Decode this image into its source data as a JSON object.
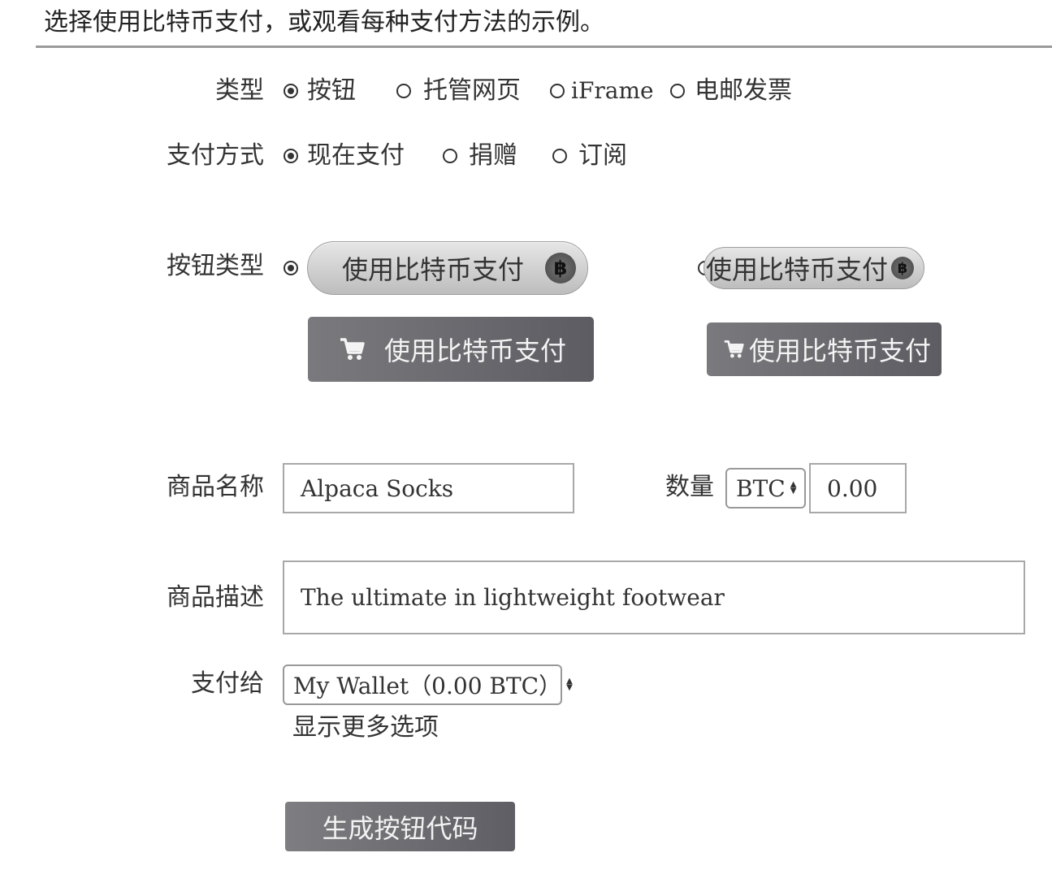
{
  "intro": "选择使用比特币支付，或观看每种支付方法的示例。",
  "type_row": {
    "label": "类型",
    "options": [
      "按钮",
      "托管网页",
      "iFrame",
      "电邮发票"
    ],
    "selected": "按钮"
  },
  "method_row": {
    "label": "支付方式",
    "options": [
      "现在支付",
      "捐赠",
      "订阅"
    ],
    "selected": "现在支付"
  },
  "button_style": {
    "label": "按钮类型",
    "button_text": "使用比特币支付",
    "coin_symbol": "฿",
    "cart_icon": "cart-icon",
    "coin_icon": "bitcoin-icon",
    "selected_index": 0
  },
  "item": {
    "name_label": "商品名称",
    "name_value": "Alpaca Socks",
    "qty_label": "数量",
    "currency": "BTC",
    "amount": "0.00",
    "desc_label": "商品描述",
    "desc_value": "The ultimate in lightweight footwear"
  },
  "pay_to": {
    "label": "支付给",
    "wallet": "My Wallet（0.00 BTC）",
    "more_options": "显示更多选项"
  },
  "generate_button": "生成按钮代码",
  "colors": {
    "dark_button": "#6b6b70",
    "light_button": "#d2d2d2",
    "rule": "#9a9a9a"
  }
}
